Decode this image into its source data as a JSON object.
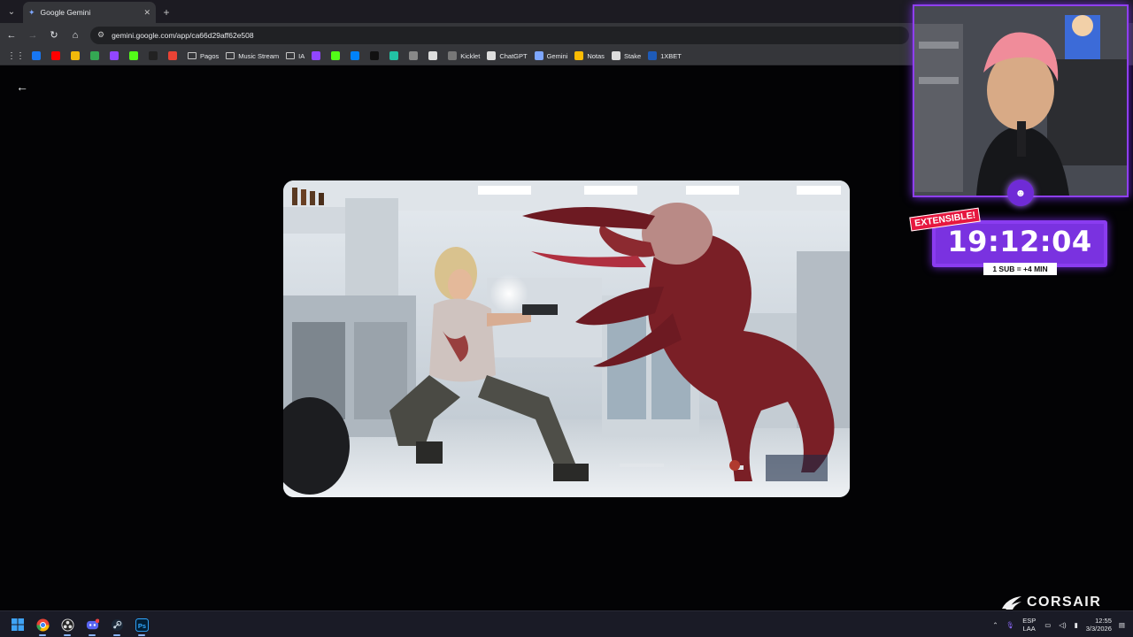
{
  "browser": {
    "tab": {
      "title": "Google Gemini",
      "icon": "gemini-spark-icon"
    },
    "url": "gemini.google.com/app/ca66d29aff62e508",
    "bookmarks": [
      {
        "label": "",
        "icon": "facebook-icon",
        "color": "#1877f2"
      },
      {
        "label": "",
        "icon": "youtube-icon",
        "color": "#ff0000"
      },
      {
        "label": "",
        "icon": "binance-icon",
        "color": "#f0b90b"
      },
      {
        "label": "",
        "icon": "drive-icon",
        "color": "#34a853"
      },
      {
        "label": "",
        "icon": "twitch-icon",
        "color": "#9146ff"
      },
      {
        "label": "",
        "icon": "kick-icon",
        "color": "#53fc18"
      },
      {
        "label": "",
        "icon": "p-icon",
        "color": "#222222"
      },
      {
        "label": "",
        "icon": "gmail-icon",
        "color": "#ea4335"
      },
      {
        "label": "Pagos",
        "icon": "folder-icon"
      },
      {
        "label": "Music Stream",
        "icon": "folder-icon"
      },
      {
        "label": "IA",
        "icon": "folder-icon"
      },
      {
        "label": "",
        "icon": "twitch-icon",
        "color": "#9146ff"
      },
      {
        "label": "",
        "icon": "kick-icon",
        "color": "#53fc18"
      },
      {
        "label": "",
        "icon": "meta-icon",
        "color": "#0082fb"
      },
      {
        "label": "",
        "icon": "tiktok-icon",
        "color": "#111111"
      },
      {
        "label": "",
        "icon": "app-icon",
        "color": "#22c1a4"
      },
      {
        "label": "",
        "icon": "tool-icon",
        "color": "#888888"
      },
      {
        "label": "",
        "icon": "diamond-icon",
        "color": "#dddddd"
      },
      {
        "label": "Kicklet",
        "icon": "kicklet-icon",
        "color": "#777777"
      },
      {
        "label": "ChatGPT",
        "icon": "chatgpt-icon",
        "color": "#dddddd"
      },
      {
        "label": "Gemini",
        "icon": "gemini-icon",
        "color": "#7ea7ff"
      },
      {
        "label": "Notas",
        "icon": "notes-icon",
        "color": "#fbbc04"
      },
      {
        "label": "Stake",
        "icon": "stake-icon",
        "color": "#dddddd"
      },
      {
        "label": "1XBET",
        "icon": "1xbet-icon",
        "color": "#1e5bb8"
      }
    ]
  },
  "overlay": {
    "timer": "19:12:04",
    "tag": "EXTENSIBLE!",
    "sub_rule": "1 SUB = +4 MIN",
    "brand": "CORSAIR"
  },
  "taskbar": {
    "icons": [
      "windows-start-icon",
      "chrome-icon",
      "obs-icon",
      "discord-icon",
      "steam-icon",
      "photoshop-icon"
    ],
    "language_top": "ESP",
    "language_bottom": "LAA",
    "time": "12:55",
    "date": "3/3/2026"
  }
}
